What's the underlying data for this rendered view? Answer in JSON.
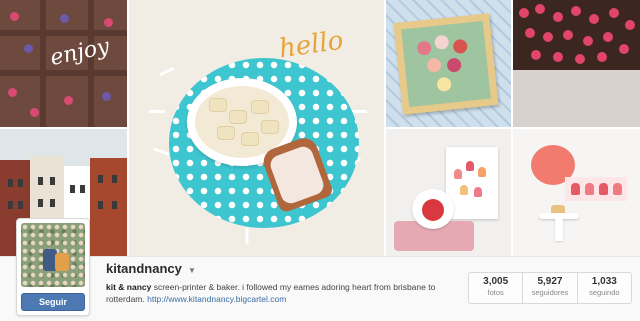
{
  "mosaic": {
    "tile1_overlay_text": "enjoy",
    "center_overlay_text": "hello"
  },
  "profile": {
    "username": "kitandnancy",
    "follow_label": "Seguir",
    "bio_name": "kit & nancy",
    "bio_text": " screen-printer & baker. i followed my eames adoring heart from brisbane to rotterdam. ",
    "bio_link": "http://www.kitandnancy.bigcartel.com",
    "stats": [
      {
        "value": "3,005",
        "label": "fotos"
      },
      {
        "value": "5,927",
        "label": "seguidores"
      },
      {
        "value": "1,033",
        "label": "seguindo"
      }
    ]
  },
  "colors": {
    "follow_button": "#4c79b2",
    "plate": "#3ec6d0",
    "link": "#3a6ea5"
  },
  "icons": {
    "username_menu": "chevron-down-icon"
  }
}
